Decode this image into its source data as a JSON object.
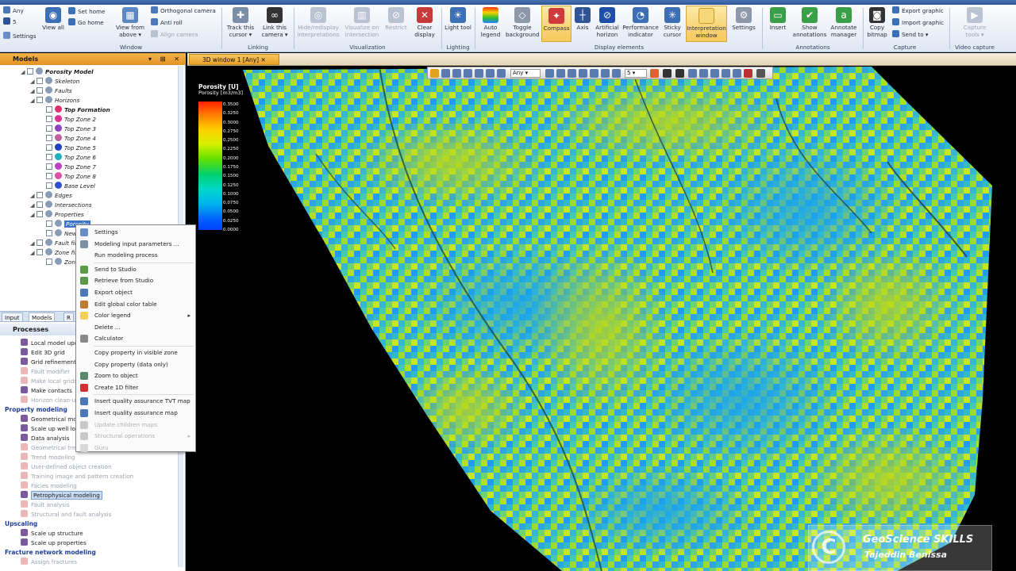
{
  "ribbon": {
    "small_left": {
      "zoom_value": "Any",
      "z_value": "5",
      "settings": "Settings"
    },
    "window_group": {
      "label": "Window",
      "view_all": "View all",
      "set_home": "Set home",
      "go_home": "Go home",
      "view_from_above": "View from above ▾",
      "orthogonal_camera": "Orthogonal camera",
      "anti_roll": "Anti roll",
      "align_camera": "Align camera"
    },
    "linking_group": {
      "label": "Linking",
      "track_this_cursor": "Track this cursor ▾",
      "link_this_camera": "Link this camera ▾"
    },
    "visualization_group": {
      "label": "Visualization",
      "hide_redisplay": "Hide/redisplay interpretations",
      "visualize_intersection": "Visualize on intersection",
      "restrict": "Restrict",
      "clear_display": "Clear display"
    },
    "lighting_group": {
      "label": "Lighting",
      "light_tool": "Light tool"
    },
    "display_group": {
      "label": "Display elements",
      "auto_legend": "Auto legend",
      "toggle_background": "Toggle background",
      "compass": "Compass",
      "axis": "Axis",
      "artificial_horizon": "Artificial horizon",
      "performance_indicator": "Performance indicator",
      "sticky_cursor": "Sticky cursor",
      "interpretation_window": "Interpretation window",
      "settings": "Settings"
    },
    "annotations_group": {
      "label": "Annotations",
      "insert": "Insert",
      "show_annotations": "Show annotations",
      "annotate_manager": "Annotate manager"
    },
    "capture_group": {
      "label": "Capture",
      "copy_bitmap": "Copy bitmap",
      "export_graphic": "Export graphic",
      "import_graphic": "Import graphic",
      "send_to": "Send to ▾"
    },
    "video_group": {
      "label": "Video capture",
      "capture_tools": "Capture tools ▾"
    }
  },
  "models_panel": {
    "title": "Models",
    "tree": [
      {
        "label": "Porosity Model",
        "bold": true,
        "level": 0
      },
      {
        "label": "Skeleton",
        "level": 1
      },
      {
        "label": "Faults",
        "level": 1
      },
      {
        "label": "Horizons",
        "level": 1
      },
      {
        "label": "Top Formation",
        "level": 2,
        "bold": true,
        "color": "#e0306a"
      },
      {
        "label": "Top Zone 2",
        "level": 2,
        "color": "#e03090"
      },
      {
        "label": "Top Zone 3",
        "level": 2,
        "color": "#9040c0"
      },
      {
        "label": "Top Zone 4",
        "level": 2,
        "color": "#c060a0"
      },
      {
        "label": "Top Zone 5",
        "level": 2,
        "color": "#2040c0"
      },
      {
        "label": "Top Zone 6",
        "level": 2,
        "color": "#20b0c0"
      },
      {
        "label": "Top Zone 7",
        "level": 2,
        "color": "#c040c0"
      },
      {
        "label": "Top Zone 8",
        "level": 2,
        "color": "#e050a0"
      },
      {
        "label": "Base Level",
        "level": 2,
        "color": "#3050d0"
      },
      {
        "label": "Edges",
        "level": 1
      },
      {
        "label": "Intersections",
        "level": 1
      },
      {
        "label": "Properties",
        "level": 1
      },
      {
        "label": "Porosity",
        "level": 2,
        "selected": true
      },
      {
        "label": "New",
        "level": 2
      },
      {
        "label": "Fault filter",
        "level": 1
      },
      {
        "label": "Zone filter",
        "level": 1
      },
      {
        "label": "Zone",
        "level": 2
      }
    ]
  },
  "bottom_tabs": [
    "Input",
    "Models",
    "R"
  ],
  "processes_panel": {
    "title": "Processes",
    "items": [
      {
        "label": "Local model update",
        "type": "item"
      },
      {
        "label": "Edit 3D grid",
        "type": "item"
      },
      {
        "label": "Grid refinement",
        "type": "item"
      },
      {
        "label": "Fault modifier",
        "type": "dis"
      },
      {
        "label": "Make local grids",
        "type": "dis"
      },
      {
        "label": "Make contacts",
        "type": "item"
      },
      {
        "label": "Horizon clean-up",
        "type": "dis"
      },
      {
        "label": "Property modeling",
        "type": "hdr"
      },
      {
        "label": "Geometrical modeling",
        "type": "item"
      },
      {
        "label": "Scale up well logs",
        "type": "item"
      },
      {
        "label": "Data analysis",
        "type": "item"
      },
      {
        "label": "Geometrical trend modeling",
        "type": "dis"
      },
      {
        "label": "Trend modeling",
        "type": "dis"
      },
      {
        "label": "User-defined object creation",
        "type": "dis"
      },
      {
        "label": "Training image and pattern creation",
        "type": "dis"
      },
      {
        "label": "Facies modeling",
        "type": "dis"
      },
      {
        "label": "Petrophysical modeling",
        "type": "sel"
      },
      {
        "label": "Fault analysis",
        "type": "dis"
      },
      {
        "label": "Structural and fault analysis",
        "type": "dis"
      },
      {
        "label": "Upscaling",
        "type": "hdr"
      },
      {
        "label": "Scale up structure",
        "type": "item"
      },
      {
        "label": "Scale up properties",
        "type": "item"
      },
      {
        "label": "Fracture network modeling",
        "type": "hdr"
      },
      {
        "label": "Assign fractures",
        "type": "dis"
      }
    ]
  },
  "window": {
    "tab_title": "3D window 1 [Any]",
    "toolbar_any": "Any",
    "toolbar_num": "5"
  },
  "legend": {
    "title": "Porosity [U]",
    "subtitle": "Porosity [m3/m3]",
    "ticks": [
      "0.3500",
      "0.3250",
      "0.3000",
      "0.2750",
      "0.2500",
      "0.2250",
      "0.2000",
      "0.1750",
      "0.1500",
      "0.1250",
      "0.1000",
      "0.0750",
      "0.0500",
      "0.0250",
      "0.0000"
    ]
  },
  "context_menu": {
    "items": [
      {
        "label": "Settings",
        "icon": "settings-icon",
        "color": "#6a8cc8"
      },
      {
        "label": "Modeling input parameters ...",
        "icon": "grid-icon",
        "color": "#7a8fa8"
      },
      {
        "label": "Run modeling process",
        "icon": "run-icon",
        "color": "#fafafa"
      },
      {
        "sep": true
      },
      {
        "label": "Send to Studio",
        "icon": "studio-send-icon",
        "color": "#5a9a4a"
      },
      {
        "label": "Retrieve from Studio",
        "icon": "studio-retrieve-icon",
        "color": "#5a9a4a"
      },
      {
        "label": "Export object",
        "icon": "export-icon",
        "color": "#4a78b8"
      },
      {
        "label": "Edit global color table",
        "icon": "color-table-icon",
        "color": "#c07a30"
      },
      {
        "label": "Color legend",
        "icon": "check-icon",
        "color": "#f2d05a",
        "arrow": true
      },
      {
        "label": "Delete ...",
        "icon": "delete-icon",
        "color": "#fafafa"
      },
      {
        "label": "Calculator",
        "icon": "calculator-icon",
        "color": "#8a8a8a"
      },
      {
        "sep": true
      },
      {
        "label": "Copy property in visible zone",
        "icon": "",
        "color": "#fafafa"
      },
      {
        "label": "Copy property (data only)",
        "icon": "",
        "color": "#fafafa"
      },
      {
        "label": "Zoom to object",
        "icon": "zoom-icon",
        "color": "#5a8a6a"
      },
      {
        "label": "Create 1D filter",
        "icon": "filter-icon",
        "color": "#d03030"
      },
      {
        "sep": true
      },
      {
        "label": "Insert quality assurance TVT map",
        "icon": "qa-icon",
        "color": "#4a78b8"
      },
      {
        "label": "Insert quality assurance map",
        "icon": "qa-icon",
        "color": "#4a78b8"
      },
      {
        "label": "Update children maps",
        "icon": "update-icon",
        "color": "#c8c8c8",
        "disabled": true
      },
      {
        "label": "Structural operations",
        "icon": "struct-icon",
        "color": "#c8c8c8",
        "disabled": true,
        "arrow": true
      },
      {
        "label": "Guru",
        "icon": "guru-icon",
        "color": "#d8d8d8",
        "disabled": true
      }
    ]
  },
  "watermark": {
    "line1": "GeoScience SKILLS",
    "line2": "Tajeddin Benissa",
    "symbol": "C"
  }
}
